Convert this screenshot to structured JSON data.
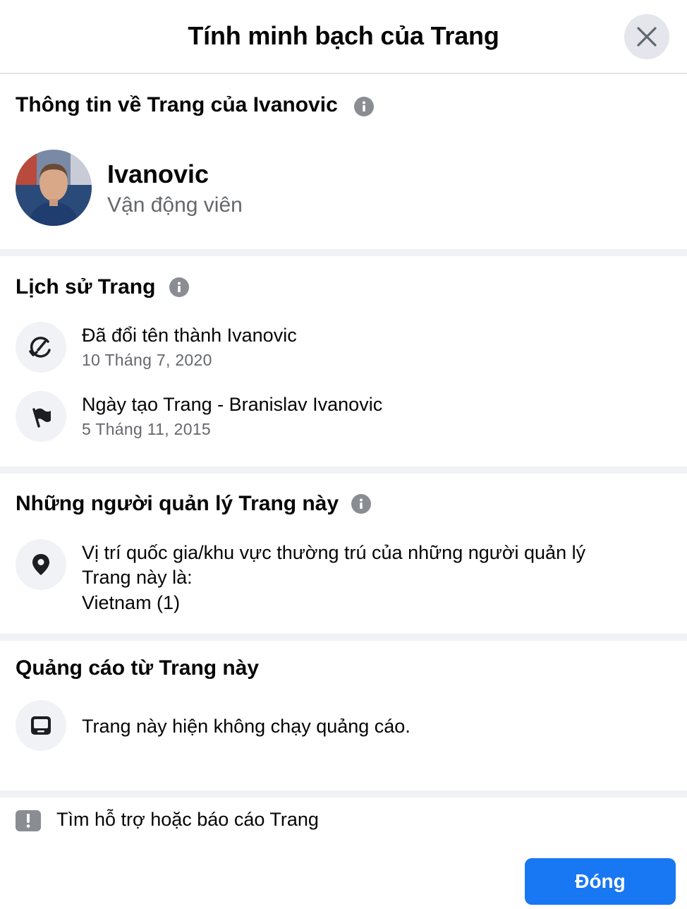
{
  "header": {
    "title": "Tính minh bạch của Trang"
  },
  "about": {
    "title": "Thông tin về Trang của Ivanovic",
    "name": "Ivanovic",
    "category": "Vận động viên"
  },
  "history": {
    "title": "Lịch sử Trang",
    "items": [
      {
        "text": "Đã đổi tên thành Ivanovic",
        "date": "10 Tháng 7, 2020",
        "icon": "rename-icon"
      },
      {
        "text": "Ngày tạo Trang - Branislav Ivanovic",
        "date": "5 Tháng 11, 2015",
        "icon": "flag-icon"
      }
    ]
  },
  "managers": {
    "title": "Những người quản lý Trang này",
    "line1": "Vị trí quốc gia/khu vực thường trú của những người quản lý",
    "line2": "Trang này là:",
    "line3": "Vietnam (1)",
    "icon": "location-pin-icon"
  },
  "ads": {
    "title": "Quảng cáo từ Trang này",
    "text": "Trang này hiện không chạy quảng cáo.",
    "icon": "ads-screen-icon"
  },
  "report": {
    "label": "Tìm hỗ trợ hoặc báo cáo Trang"
  },
  "footer": {
    "close_label": "Đóng"
  },
  "colors": {
    "primary": "#1877f2",
    "secondary_text": "#65676b",
    "icon_bg": "#f0f2f5"
  }
}
